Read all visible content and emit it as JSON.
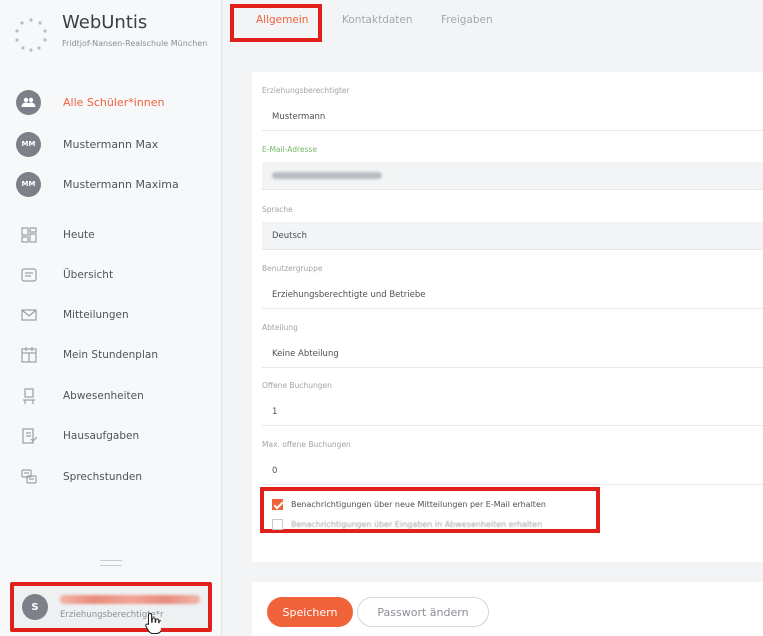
{
  "brand": {
    "name": "WebUntis",
    "school": "Fridtjof-Nansen-Realschule München"
  },
  "students": [
    {
      "initials": "",
      "label": "Alle Schüler*innen",
      "active": true
    },
    {
      "initials": "MM",
      "label": "Mustermann Max",
      "active": false
    },
    {
      "initials": "MM",
      "label": "Mustermann Maxima",
      "active": false
    }
  ],
  "nav": [
    {
      "icon": "dashboard-icon",
      "label": "Heute"
    },
    {
      "icon": "overview-icon",
      "label": "Übersicht"
    },
    {
      "icon": "mail-icon",
      "label": "Mitteilungen"
    },
    {
      "icon": "calendar-icon",
      "label": "Mein Stundenplan"
    },
    {
      "icon": "absence-icon",
      "label": "Abwesenheiten"
    },
    {
      "icon": "homework-icon",
      "label": "Hausaufgaben"
    },
    {
      "icon": "consultation-icon",
      "label": "Sprechstunden"
    }
  ],
  "user": {
    "initial": "S",
    "role": "Erziehungsberechtigte*r"
  },
  "tabs": [
    {
      "label": "Allgemein",
      "active": true
    },
    {
      "label": "Kontaktdaten",
      "active": false
    },
    {
      "label": "Freigaben",
      "active": false
    }
  ],
  "form": {
    "guardian_label": "Erziehungsberechtigter",
    "guardian_value": "Mustermann",
    "email_label": "E-Mail-Adresse",
    "language_label": "Sprache",
    "language_value": "Deutsch",
    "usergroup_label": "Benutzergruppe",
    "usergroup_value": "Erziehungsberechtigte und Betriebe",
    "department_label": "Abteilung",
    "department_value": "Keine Abteilung",
    "open_bookings_label": "Offene Buchungen",
    "open_bookings_value": "1",
    "max_bookings_label": "Max. offene Buchungen",
    "max_bookings_value": "0",
    "notify_messages": "Benachrichtigungen über neue Mitteilungen per E-Mail erhalten",
    "notify_second": "Benachrichtigungen über Eingaben in Abwesenheiten erhalten"
  },
  "actions": {
    "save": "Speichern",
    "change_password": "Passwort ändern"
  },
  "colors": {
    "accent": "#f0623a",
    "highlight": "#e0201b"
  }
}
